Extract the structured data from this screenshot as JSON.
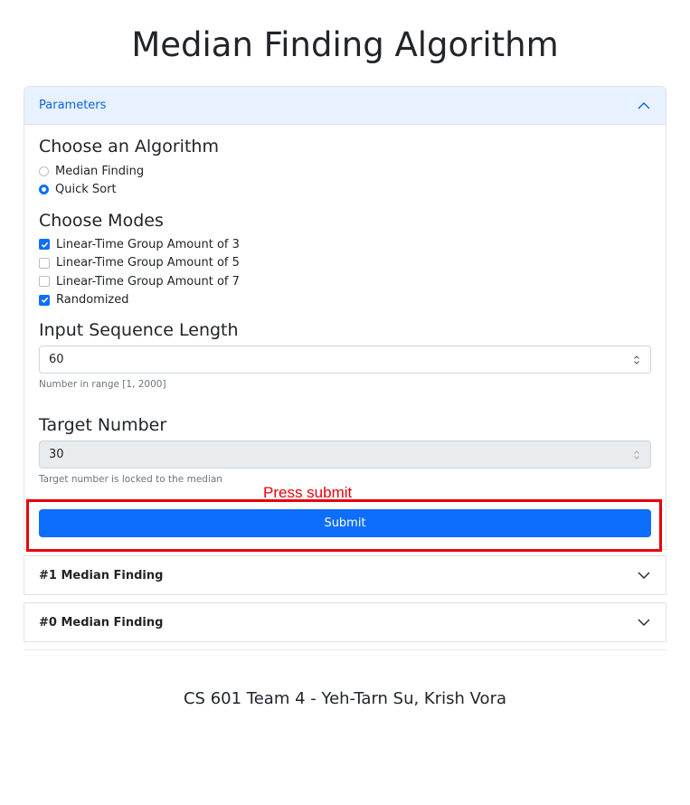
{
  "page": {
    "title": "Median Finding Algorithm"
  },
  "params": {
    "header": "Parameters",
    "algorithm": {
      "title": "Choose an Algorithm",
      "options": [
        {
          "label": "Median Finding",
          "selected": false
        },
        {
          "label": "Quick Sort",
          "selected": true
        }
      ]
    },
    "modes": {
      "title": "Choose Modes",
      "options": [
        {
          "label": "Linear-Time Group Amount of 3",
          "checked": true
        },
        {
          "label": "Linear-Time Group Amount of 5",
          "checked": false
        },
        {
          "label": "Linear-Time Group Amount of 7",
          "checked": false
        },
        {
          "label": "Randomized",
          "checked": true
        }
      ]
    },
    "length": {
      "title": "Input Sequence Length",
      "value": "60",
      "help": "Number in range [1, 2000]"
    },
    "target": {
      "title": "Target Number",
      "value": "30",
      "help": "Target number is locked to the median",
      "disabled": true
    },
    "submit_label": "Submit"
  },
  "results": [
    {
      "label": "#1 Median Finding"
    },
    {
      "label": "#0 Median Finding"
    }
  ],
  "annotation": {
    "text": "Press submit",
    "color": "#e8000b"
  },
  "footer": {
    "text": "CS 601 Team 4 - Yeh-Tarn Su, Krish Vora"
  },
  "colors": {
    "primary": "#0d6efd",
    "accordion_active_bg": "#e7f1ff"
  }
}
